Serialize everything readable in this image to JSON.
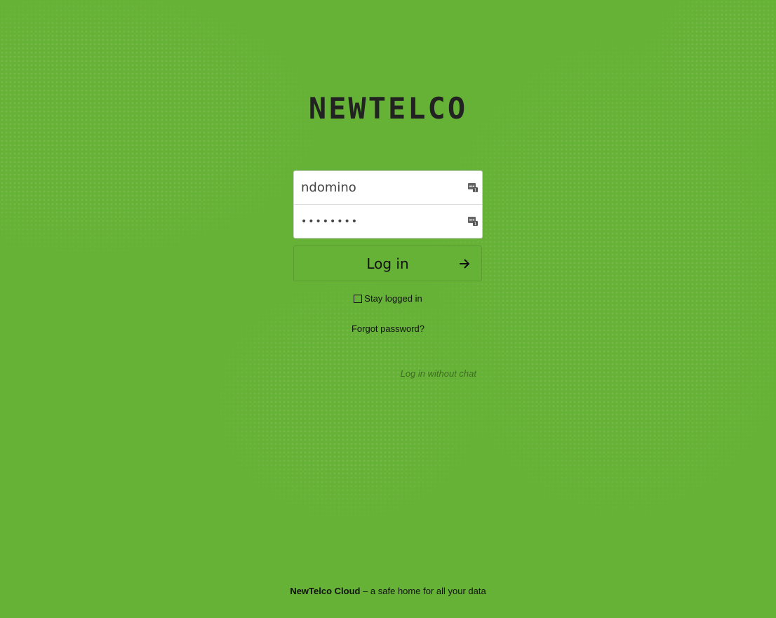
{
  "brand": {
    "logo_text": "NEWTELCO"
  },
  "login": {
    "username_value": "ndomino",
    "password_masked": "••••••••",
    "submit_label": "Log in",
    "stay_logged_in_label": "Stay logged in",
    "stay_logged_in_checked": false,
    "forgot_password_label": "Forgot password?",
    "login_without_chat_label": "Log in without chat"
  },
  "footer": {
    "brand": "NewTelco Cloud",
    "tagline": " – a safe home for all your data"
  },
  "icons": {
    "field_icon": "password-manager-icon",
    "submit_icon": "arrow-right-icon"
  },
  "colors": {
    "background": "#66b237",
    "text": "#111111"
  }
}
